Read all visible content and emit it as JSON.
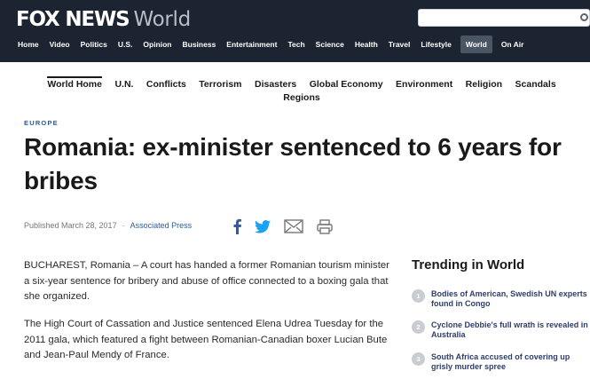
{
  "header": {
    "logo_primary": "FOX NEWS",
    "logo_section": "World",
    "search_placeholder": "",
    "nav": [
      "Home",
      "Video",
      "Politics",
      "U.S.",
      "Opinion",
      "Business",
      "Entertainment",
      "Tech",
      "Science",
      "Health",
      "Travel",
      "Lifestyle",
      "World",
      "On Air"
    ],
    "nav_active": "World"
  },
  "subnav": {
    "items": [
      "World Home",
      "U.N.",
      "Conflicts",
      "Terrorism",
      "Disasters",
      "Global Economy",
      "Environment",
      "Religion",
      "Scandals",
      "Regions"
    ],
    "active": "World Home"
  },
  "article": {
    "category": "EUROPE",
    "headline": "Romania: ex-minister sentenced to 6 years for bribes",
    "published": "Published March 28, 2017",
    "separator": "·",
    "source": "Associated Press",
    "paragraphs": [
      "BUCHAREST, Romania –  A court has handed a former Romanian tourism minister a six-year sentence for bribery and abuse of office connected to a boxing gala that she organized.",
      "The High Court of Cassation and Justice sentenced Elena Udrea Tuesday for the 2011 gala, which featured a fight between Romanian-Canadian boxer Lucian Bute and Jean-Paul Mendy of France."
    ]
  },
  "share": {
    "icons": [
      "facebook-icon",
      "twitter-icon",
      "email-icon",
      "print-icon"
    ],
    "facebook_color": "#3b5998",
    "twitter_color": "#1da1f2",
    "neutral_color": "#777777"
  },
  "trending": {
    "title": "Trending in World",
    "items": [
      {
        "num": "1",
        "text": "Bodies of American, Swedish UN experts found in Congo"
      },
      {
        "num": "2",
        "text": "Cyclone Debbie's full wrath is revealed in Australia"
      },
      {
        "num": "3",
        "text": "South Africa accused of covering up grisly murder spree"
      }
    ]
  },
  "colors": {
    "header_bg": "#1b2430",
    "accent_blue": "#2c5b9c",
    "trending_link": "#2c3e6b"
  }
}
